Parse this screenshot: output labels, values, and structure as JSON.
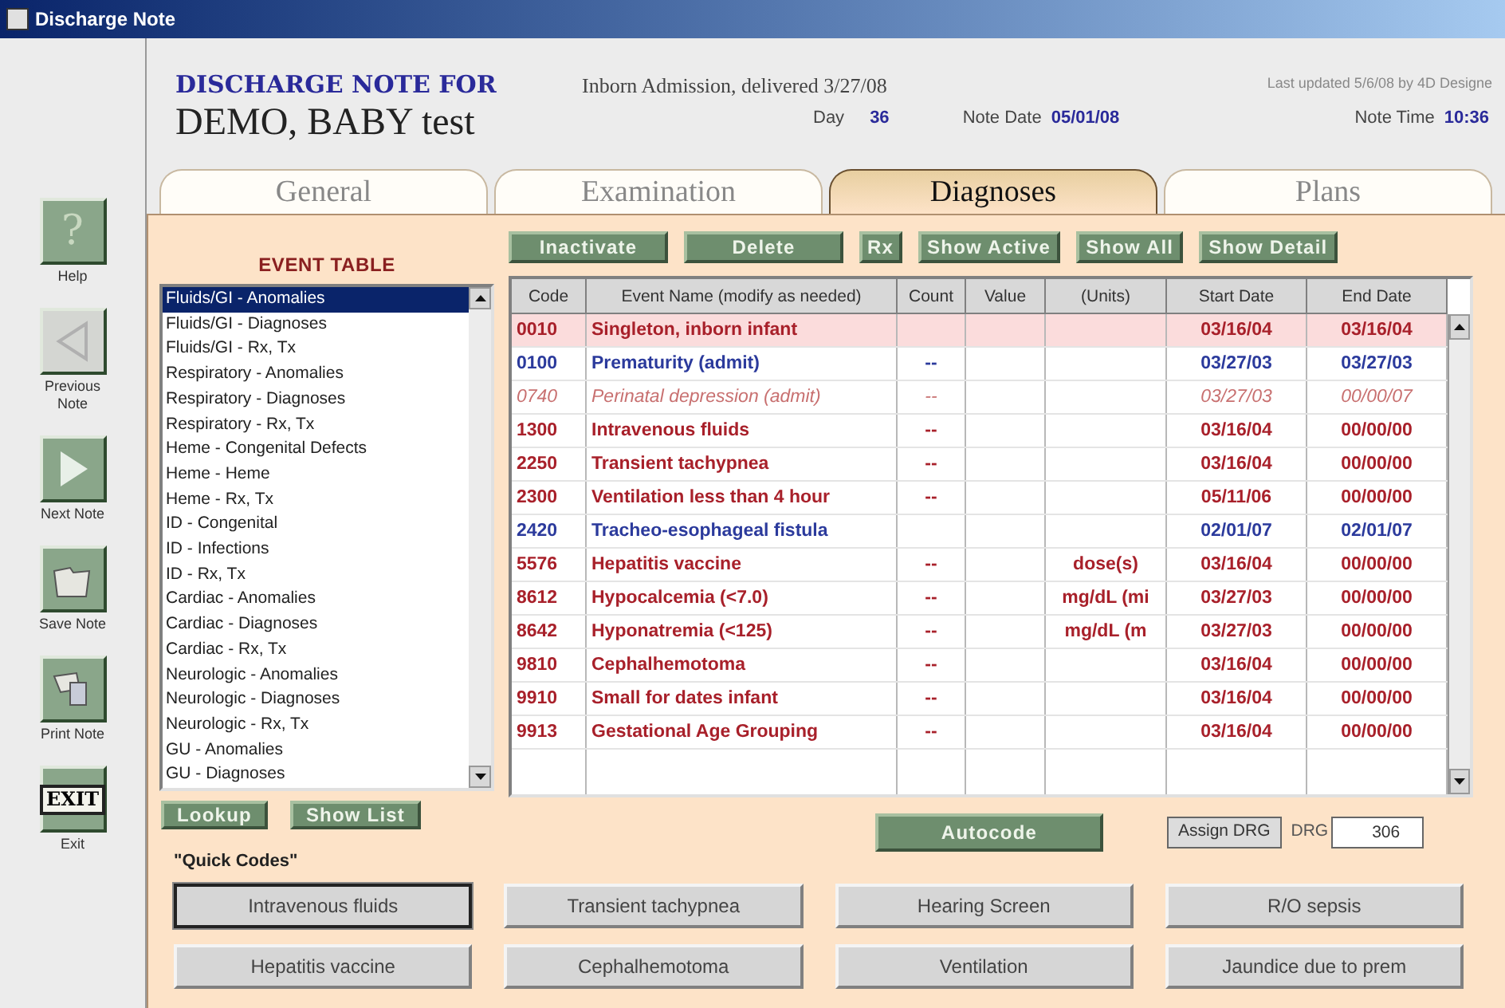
{
  "window": {
    "title": "Discharge Note"
  },
  "header": {
    "heading": "DISCHARGE NOTE FOR",
    "patient": "DEMO, BABY test",
    "admission": "Inborn Admission, delivered 3/27/08",
    "last_updated": "Last updated 5/6/08 by 4D Designe",
    "day_label": "Day",
    "day": "36",
    "note_date_label": "Note Date",
    "note_date": "05/01/08",
    "note_time_label": "Note Time",
    "note_time": "10:36"
  },
  "toolbar": [
    {
      "kind": "help",
      "label": "Help",
      "icon_text": "?",
      "disabled": false
    },
    {
      "kind": "previous",
      "label": "Previous Note",
      "disabled": true
    },
    {
      "kind": "next",
      "label": "Next Note",
      "disabled": false
    },
    {
      "kind": "save",
      "label": "Save Note",
      "disabled": false
    },
    {
      "kind": "print",
      "label": "Print Note",
      "disabled": false
    },
    {
      "kind": "exit",
      "label": "Exit",
      "icon_text": "EXIT",
      "disabled": false
    }
  ],
  "tabs": [
    {
      "label": "General",
      "selected": false
    },
    {
      "label": "Examination",
      "selected": false
    },
    {
      "label": "Diagnoses",
      "selected": true
    },
    {
      "label": "Plans",
      "selected": false
    }
  ],
  "event_table": {
    "title": "EVENT TABLE",
    "items": [
      {
        "label": "Fluids/GI - Anomalies",
        "selected": true
      },
      {
        "label": "Fluids/GI - Diagnoses",
        "selected": false
      },
      {
        "label": "Fluids/GI - Rx, Tx",
        "selected": false
      },
      {
        "label": "Respiratory - Anomalies",
        "selected": false
      },
      {
        "label": "Respiratory - Diagnoses",
        "selected": false
      },
      {
        "label": "Respiratory - Rx, Tx",
        "selected": false
      },
      {
        "label": "Heme - Congenital Defects",
        "selected": false
      },
      {
        "label": "Heme - Heme",
        "selected": false
      },
      {
        "label": "Heme - Rx, Tx",
        "selected": false
      },
      {
        "label": "ID - Congenital",
        "selected": false
      },
      {
        "label": "ID - Infections",
        "selected": false
      },
      {
        "label": "ID - Rx, Tx",
        "selected": false
      },
      {
        "label": "Cardiac - Anomalies",
        "selected": false
      },
      {
        "label": "Cardiac - Diagnoses",
        "selected": false
      },
      {
        "label": "Cardiac - Rx, Tx",
        "selected": false
      },
      {
        "label": "Neurologic - Anomalies",
        "selected": false
      },
      {
        "label": "Neurologic - Diagnoses",
        "selected": false
      },
      {
        "label": "Neurologic - Rx, Tx",
        "selected": false
      },
      {
        "label": "GU - Anomalies",
        "selected": false
      },
      {
        "label": "GU - Diagnoses",
        "selected": false
      }
    ],
    "buttons": [
      "Lookup",
      "Show List"
    ]
  },
  "actions": [
    "Inactivate",
    "Delete",
    "Rx",
    "Show Active",
    "Show All",
    "Show Detail"
  ],
  "table": {
    "columns": [
      "Code",
      "Event Name (modify as needed)",
      "Count",
      "Value",
      "(Units)",
      "Start Date",
      "End Date"
    ],
    "rows": [
      {
        "code": "0010",
        "name": "Singleton, inborn infant",
        "count": "",
        "value": "",
        "units": "",
        "start": "03/16/04",
        "end": "03/16/04",
        "color": "#a8202a",
        "inactive": false,
        "selected": true
      },
      {
        "code": "0100",
        "name": "Prematurity (admit)",
        "count": "--",
        "value": "",
        "units": "",
        "start": "03/27/03",
        "end": "03/27/03",
        "color": "#2b3a9c",
        "inactive": false,
        "selected": false
      },
      {
        "code": "0740",
        "name": "Perinatal depression (admit)",
        "count": "--",
        "value": "",
        "units": "",
        "start": "03/27/03",
        "end": "00/00/07",
        "color": "#c87070",
        "inactive": true,
        "selected": false
      },
      {
        "code": "1300",
        "name": "Intravenous fluids",
        "count": "--",
        "value": "",
        "units": "",
        "start": "03/16/04",
        "end": "00/00/00",
        "color": "#a8202a",
        "inactive": false,
        "selected": false
      },
      {
        "code": "2250",
        "name": "Transient tachypnea",
        "count": "--",
        "value": "",
        "units": "",
        "start": "03/16/04",
        "end": "00/00/00",
        "color": "#a8202a",
        "inactive": false,
        "selected": false
      },
      {
        "code": "2300",
        "name": "Ventilation less than 4 hour",
        "count": "--",
        "value": "",
        "units": "",
        "start": "05/11/06",
        "end": "00/00/00",
        "color": "#a8202a",
        "inactive": false,
        "selected": false
      },
      {
        "code": "2420",
        "name": "Tracheo-esophageal fistula",
        "count": "",
        "value": "",
        "units": "",
        "start": "02/01/07",
        "end": "02/01/07",
        "color": "#2b3a9c",
        "inactive": false,
        "selected": false
      },
      {
        "code": "5576",
        "name": "Hepatitis vaccine",
        "count": "--",
        "value": "",
        "units": "dose(s)",
        "start": "03/16/04",
        "end": "00/00/00",
        "color": "#a8202a",
        "inactive": false,
        "selected": false
      },
      {
        "code": "8612",
        "name": "Hypocalcemia (<7.0)",
        "count": "--",
        "value": "",
        "units": "mg/dL (mi",
        "start": "03/27/03",
        "end": "00/00/00",
        "color": "#a8202a",
        "inactive": false,
        "selected": false
      },
      {
        "code": "8642",
        "name": "Hyponatremia (<125)",
        "count": "--",
        "value": "",
        "units": "mg/dL (m",
        "start": "03/27/03",
        "end": "00/00/00",
        "color": "#a8202a",
        "inactive": false,
        "selected": false
      },
      {
        "code": "9810",
        "name": "Cephalhemotoma",
        "count": "--",
        "value": "",
        "units": "",
        "start": "03/16/04",
        "end": "00/00/00",
        "color": "#a8202a",
        "inactive": false,
        "selected": false
      },
      {
        "code": "9910",
        "name": "Small for dates infant",
        "count": "--",
        "value": "",
        "units": "",
        "start": "03/16/04",
        "end": "00/00/00",
        "color": "#a8202a",
        "inactive": false,
        "selected": false
      },
      {
        "code": "9913",
        "name": "Gestational Age Grouping",
        "count": "--",
        "value": "",
        "units": "",
        "start": "03/16/04",
        "end": "00/00/00",
        "color": "#a8202a",
        "inactive": false,
        "selected": false
      }
    ]
  },
  "autocode": "Autocode",
  "assign_drg": "Assign DRG",
  "drg": {
    "label": "DRG",
    "value": "306"
  },
  "quick_codes": {
    "title": "\"Quick Codes\"",
    "items": [
      {
        "label": "Intravenous fluids",
        "selected": true
      },
      {
        "label": "Transient tachypnea",
        "selected": false
      },
      {
        "label": "Hearing Screen",
        "selected": false
      },
      {
        "label": "R/O sepsis",
        "selected": false
      },
      {
        "label": "Hepatitis vaccine",
        "selected": false
      },
      {
        "label": "Cephalhemotoma",
        "selected": false
      },
      {
        "label": "Ventilation",
        "selected": false
      },
      {
        "label": "Jaundice due to prem",
        "selected": false
      }
    ]
  }
}
